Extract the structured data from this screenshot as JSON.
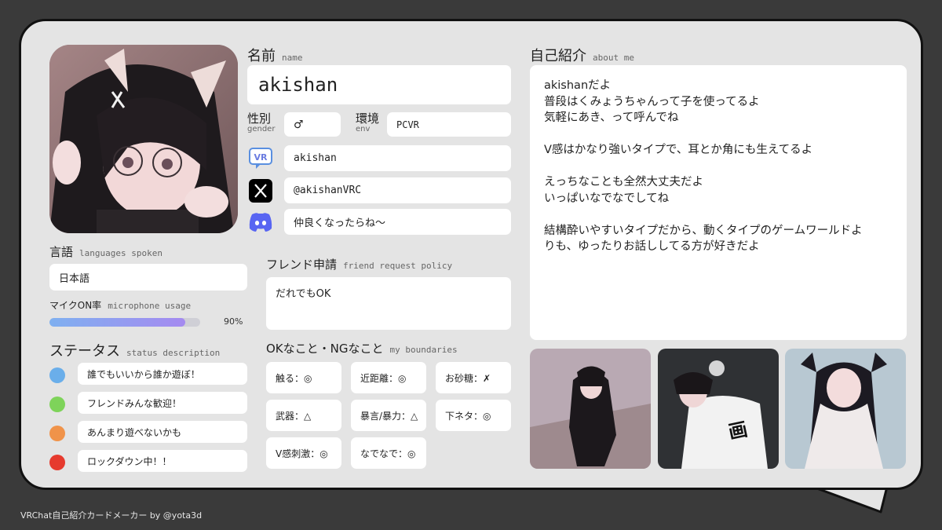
{
  "name": {
    "label_jp": "名前",
    "label_en": "name",
    "value": "akishan"
  },
  "gender": {
    "label_jp": "性別",
    "label_en": "gender",
    "value": "♂"
  },
  "env": {
    "label_jp": "環境",
    "label_en": "env",
    "value": "PCVR"
  },
  "sns": {
    "vrchat": "akishan",
    "x": "@akishanVRC",
    "discord": "仲良くなったらね〜"
  },
  "languages": {
    "label_jp": "言語",
    "label_en": "languages spoken",
    "value": "日本語"
  },
  "mic": {
    "label_jp": "マイクON率",
    "label_en": "microphone usage",
    "value": "90%",
    "percent": 90
  },
  "status": {
    "label_jp": "ステータス",
    "label_en": "status description",
    "items": [
      {
        "text": "誰でもいいから誰か遊ぼ！",
        "color": "#6aaeea"
      },
      {
        "text": "フレンドみんな歓迎！",
        "color": "#7ed35a"
      },
      {
        "text": "あんまり遊べないかも",
        "color": "#f0934a"
      },
      {
        "text": "ロックダウン中！！",
        "color": "#e63a2e"
      }
    ]
  },
  "friend": {
    "label_jp": "フレンド申請",
    "label_en": "friend request policy",
    "value": "だれでもOK"
  },
  "boundaries": {
    "label_jp": "OKなこと・NGなこと",
    "label_en": "my boundaries",
    "items": [
      "触る：◎",
      "近距離：◎",
      "お砂糖：✗",
      "武器：△",
      "暴言/暴力：△",
      "下ネタ：◎",
      "V感刺激：◎",
      "なでなで：◎"
    ]
  },
  "about": {
    "label_jp": "自己紹介",
    "label_en": "about me",
    "lines": [
      "akishanだよ",
      "普段はくみょうちゃんって子を使ってるよ",
      "気軽にあき、って呼んでね",
      "",
      "V感はかなり強いタイプで、耳とか角にも生えてるよ",
      "",
      "えっちなことも全然大丈夫だよ",
      "いっぱいなでなでしてね",
      "",
      "結構酔いやすいタイプだから、動くタイプのゲームワールドよ",
      "りも、ゆったりお話ししてる方が好きだよ"
    ]
  },
  "footer": "VRChat自己紹介カードメーカー by @yota3d",
  "colors": {
    "vrchat_icon": "#5a8fe0",
    "discord": "#5865f2",
    "x_icon": "#000000"
  }
}
